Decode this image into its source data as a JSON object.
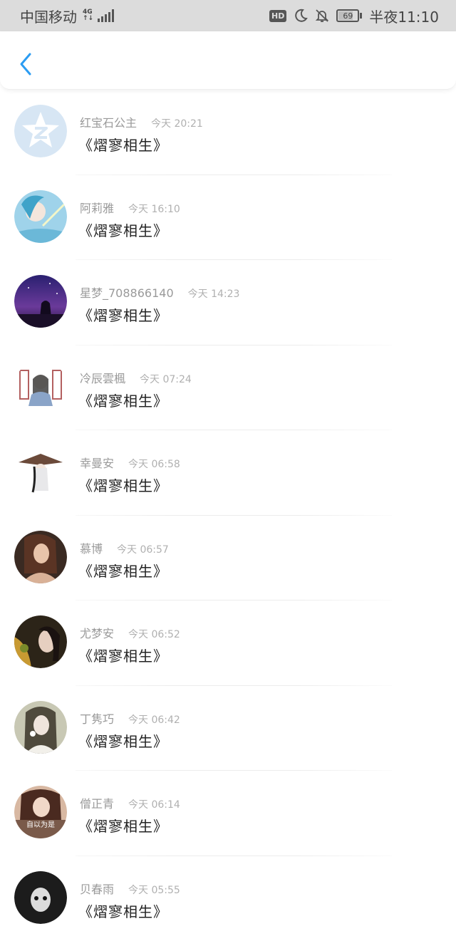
{
  "status_bar": {
    "carrier": "中国移动",
    "network_type": "4G",
    "network_sub": "↑↓",
    "hd_badge": "HD",
    "battery_level": "69",
    "time": "半夜11:10",
    "icons": [
      "signal-icon",
      "hd-icon",
      "moon-icon",
      "bell-off-icon",
      "battery-icon"
    ]
  },
  "header": {
    "back_icon": "chevron-left-icon",
    "accent_color": "#2b9cf2"
  },
  "messages": [
    {
      "name": "红宝石公主",
      "time": "今天 20:21",
      "message": "《熠寥相生》"
    },
    {
      "name": "阿莉雅",
      "time": "今天 16:10",
      "message": "《熠寥相生》"
    },
    {
      "name": "星梦_708866140",
      "time": "今天 14:23",
      "message": "《熠寥相生》"
    },
    {
      "name": "冷辰雲楓",
      "time": "今天 07:24",
      "message": "《熠寥相生》"
    },
    {
      "name": "幸曼安",
      "time": "今天 06:58",
      "message": "《熠寥相生》"
    },
    {
      "name": "慕博",
      "time": "今天 06:57",
      "message": "《熠寥相生》"
    },
    {
      "name": "尤梦安",
      "time": "今天 06:52",
      "message": "《熠寥相生》"
    },
    {
      "name": "丁隽巧",
      "time": "今天 06:42",
      "message": "《熠寥相生》"
    },
    {
      "name": "僧正青",
      "time": "今天 06:14",
      "message": "《熠寥相生》",
      "avatar_caption": "自以为是"
    },
    {
      "name": "贝春雨",
      "time": "今天 05:55",
      "message": "《熠寥相生》"
    }
  ]
}
